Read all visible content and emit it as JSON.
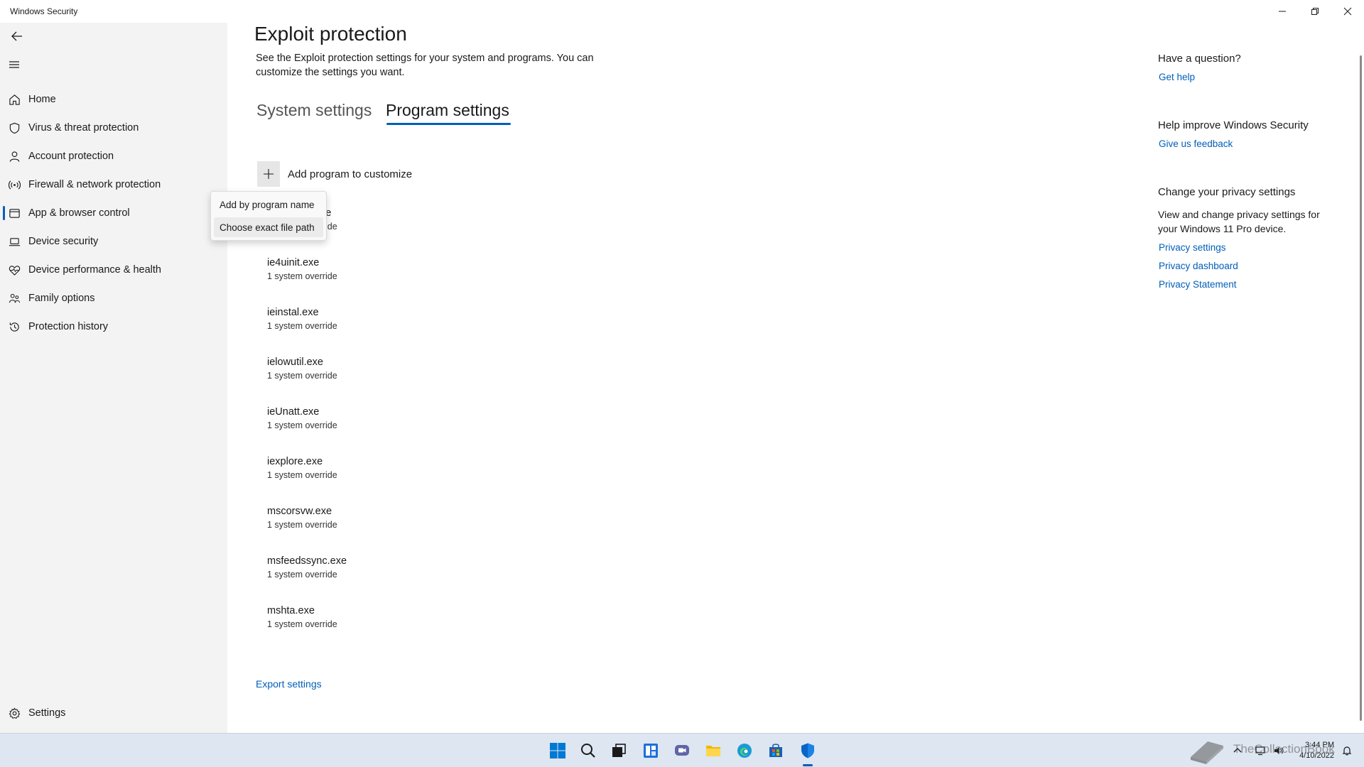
{
  "window": {
    "title": "Windows Security"
  },
  "sidebar": {
    "items": [
      {
        "label": "Home",
        "icon": "home-icon"
      },
      {
        "label": "Virus & threat protection",
        "icon": "shield-icon"
      },
      {
        "label": "Account protection",
        "icon": "person-icon"
      },
      {
        "label": "Firewall & network protection",
        "icon": "wifi-icon"
      },
      {
        "label": "App & browser control",
        "icon": "app-window-icon",
        "active": true
      },
      {
        "label": "Device security",
        "icon": "laptop-icon"
      },
      {
        "label": "Device performance & health",
        "icon": "heart-icon"
      },
      {
        "label": "Family options",
        "icon": "family-icon"
      },
      {
        "label": "Protection history",
        "icon": "history-icon"
      }
    ],
    "settings_label": "Settings"
  },
  "main": {
    "title": "Exploit protection",
    "description": "See the Exploit protection settings for your system and programs.  You can customize the settings you want.",
    "tabs": [
      {
        "label": "System settings",
        "active": false
      },
      {
        "label": "Program settings",
        "active": true
      }
    ],
    "add_program_label": "Add program to customize",
    "programs": [
      {
        "name": "ExtExport.exe",
        "sub": "1 system override"
      },
      {
        "name": "ie4uinit.exe",
        "sub": "1 system override"
      },
      {
        "name": "ieinstal.exe",
        "sub": "1 system override"
      },
      {
        "name": "ielowutil.exe",
        "sub": "1 system override"
      },
      {
        "name": "ieUnatt.exe",
        "sub": "1 system override"
      },
      {
        "name": "iexplore.exe",
        "sub": "1 system override"
      },
      {
        "name": "mscorsvw.exe",
        "sub": "1 system override"
      },
      {
        "name": "msfeedssync.exe",
        "sub": "1 system override"
      },
      {
        "name": "mshta.exe",
        "sub": "1 system override"
      }
    ],
    "export_label": "Export settings"
  },
  "context_menu": {
    "items": [
      {
        "label": "Add by program name"
      },
      {
        "label": "Choose exact file path",
        "hovered": true
      }
    ]
  },
  "right_panel": {
    "question_heading": "Have a question?",
    "get_help": "Get help",
    "improve_heading": "Help improve Windows Security",
    "feedback": "Give us feedback",
    "privacy_heading": "Change your privacy settings",
    "privacy_text": "View and change privacy settings for your Windows 11 Pro device.",
    "privacy_settings": "Privacy settings",
    "privacy_dashboard": "Privacy dashboard",
    "privacy_statement": "Privacy Statement"
  },
  "taskbar": {
    "apps": [
      "start-icon",
      "search-icon",
      "task-view-icon",
      "widgets-icon",
      "chat-icon",
      "file-explorer-icon",
      "edge-icon",
      "store-icon",
      "windows-security-icon"
    ],
    "time": "3:44 PM",
    "date": "4/10/2022"
  },
  "watermark": {
    "text": "TheCollectionBook"
  },
  "colors": {
    "accent": "#005fb8",
    "sidebar_bg": "#f3f3f3",
    "taskbar_bg": "#dde6f1"
  }
}
